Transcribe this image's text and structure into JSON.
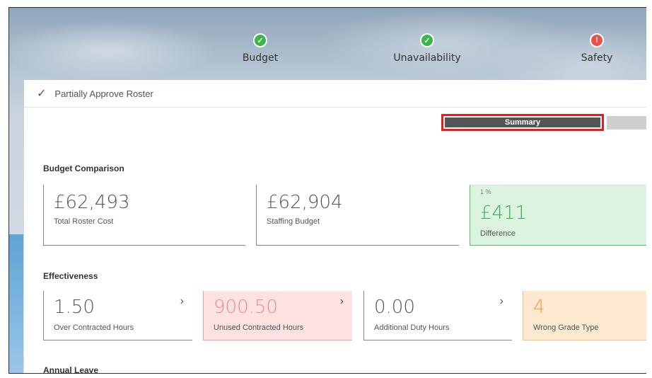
{
  "steps": [
    {
      "label": "Budget",
      "status": "ok",
      "icon": "check-icon"
    },
    {
      "label": "Unavailability",
      "status": "ok",
      "icon": "check-icon"
    },
    {
      "label": "Safety",
      "status": "warning",
      "icon": "alert-icon"
    }
  ],
  "header": {
    "title": "Partially Approve Roster"
  },
  "tabs": {
    "summary": "Summary"
  },
  "budget": {
    "heading": "Budget Comparison",
    "total_cost": {
      "value": "£62,493",
      "label": "Total Roster Cost"
    },
    "staffing_budget": {
      "value": "£62,904",
      "label": "Staffing Budget"
    },
    "difference": {
      "percent": "1 %",
      "value": "£411",
      "label": "Difference"
    }
  },
  "effectiveness": {
    "heading": "Effectiveness",
    "items": [
      {
        "value": "1.50",
        "label": "Over Contracted Hours"
      },
      {
        "value": "900.50",
        "label": "Unused Contracted Hours"
      },
      {
        "value": "0.00",
        "label": "Additional Duty Hours"
      },
      {
        "value": "4",
        "label": "Wrong Grade Type"
      }
    ]
  },
  "annual_leave": {
    "heading": "Annual Leave"
  },
  "colors": {
    "ok": "#39b54a",
    "warning": "#e8504a",
    "highlight_border": "#e0201d",
    "green": "#3aa856",
    "red": "#ef8a8a",
    "orange": "#f5a13d"
  }
}
